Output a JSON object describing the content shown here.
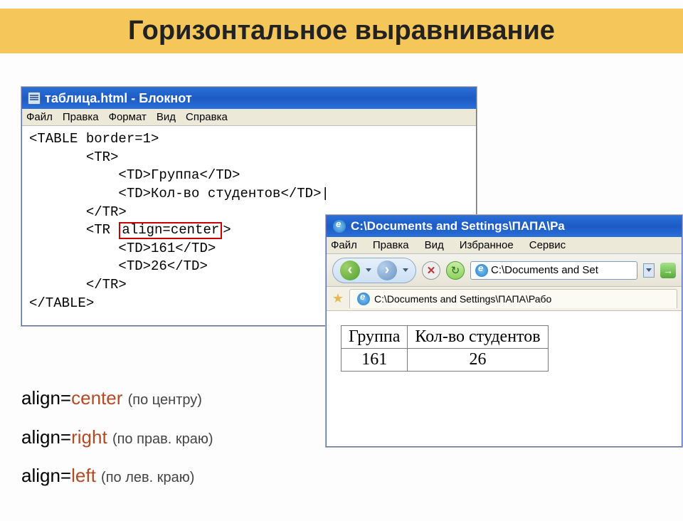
{
  "title": "Горизонтальное выравнивание",
  "notepad": {
    "window_title": "таблица.html - Блокнот",
    "menu": {
      "file": "Файл",
      "edit": "Правка",
      "format": "Формат",
      "view": "Вид",
      "help": "Справка"
    },
    "code": {
      "l1": "<TABLE border=1>",
      "l2": "       <TR>",
      "l3": "           <TD>Группа</TD>",
      "l4": "           <TD>Кол-во студентов</TD>|",
      "l5": "       </TR>",
      "l6a": "       <TR ",
      "l6hl": "align=center",
      "l6b": ">",
      "l7": "           <TD>161</TD>",
      "l8": "           <TD>26</TD>",
      "l9": "       </TR>",
      "l10": "</TABLE>"
    }
  },
  "ie": {
    "window_title": "C:\\Documents and Settings\\ПАПА\\Ра",
    "menu": {
      "file": "Файл",
      "edit": "Правка",
      "view": "Вид",
      "favorites": "Избранное",
      "tools": "Сервис"
    },
    "address_short": "C:\\Documents and Set",
    "tab_title": "C:\\Documents and Settings\\ПАПА\\Рабо",
    "table": {
      "hdr1": "Группа",
      "hdr2": "Кол-во студентов",
      "val1": "161",
      "val2": "26"
    }
  },
  "legend": {
    "l1_kw": "align=",
    "l1_val": "center",
    "l1_note": "(по центру)",
    "l2_kw": "align=",
    "l2_val": "right",
    "l2_note": "(по прав. краю)",
    "l3_kw": "align=",
    "l3_val": "left",
    "l3_note": "(по лев. краю)"
  }
}
